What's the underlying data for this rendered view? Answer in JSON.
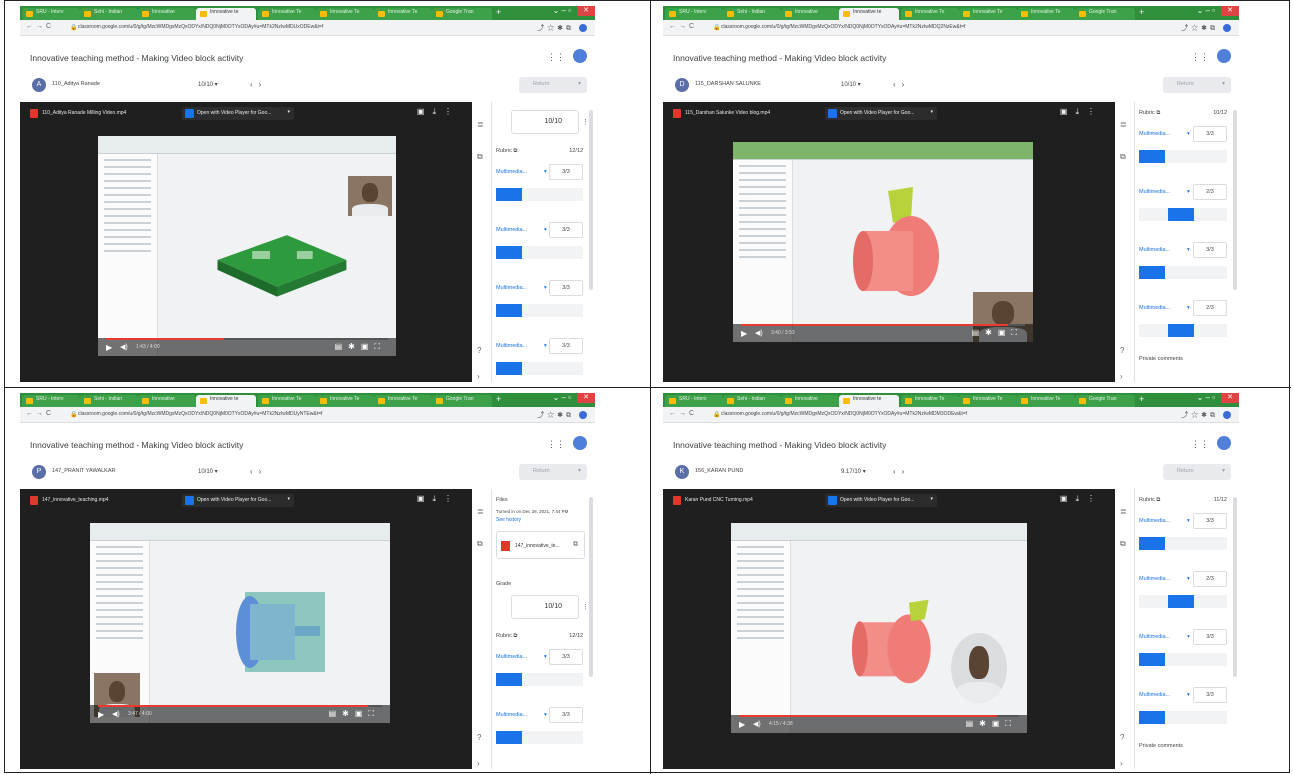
{
  "screens": [
    {
      "tabs": [
        "SRU - Interv",
        "Sehi - Indian",
        "Innovative",
        "Innovative te",
        "Innovative Te",
        "Innovative Te",
        "Innovative Te",
        "Google Tran"
      ],
      "url": "classroom.google.com/u/0/g/tg/MzcWMDgxMzQxODYx/NDQ0NjM0OTYxODAy#u=MTk2NzIwMDUxODEw&t=f",
      "title": "Innovative teaching method - Making Video block activity",
      "student": "110_Aditya Ranade",
      "student_initial": "A",
      "grade_select": "10/10",
      "return_label": "Return",
      "file_name": "110_Aditya Ranade Milling Video.mp4",
      "open_with": "Open with Video Player for Goo...",
      "time": "1:43 / 4:00",
      "progress": 0.42,
      "panel": {
        "grade_value": "10/10",
        "rubric_label": "Rubric",
        "rubric_total": "12/12",
        "criteria": [
          {
            "name": "Multimedia...",
            "score": "3/3",
            "level": 0
          },
          {
            "name": "Multimedia...",
            "score": "3/3",
            "level": 0
          },
          {
            "name": "Multimedia...",
            "score": "3/3",
            "level": 0
          },
          {
            "name": "Multimedia...",
            "score": "3/3",
            "level": 0
          }
        ]
      }
    },
    {
      "tabs": [
        "SRU - Interv",
        "Sehi - Indian",
        "Innovative",
        "Innovative te",
        "Innovative Te",
        "Innovative Te",
        "Innovative Te",
        "Google Tran"
      ],
      "url": "classroom.google.com/u/0/g/tg/MzcWMDgxMzQxODYx/NDQ0NjM0OTYxODAy#u=MTk2NzIwMDQ2NzEw&t=f",
      "title": "Innovative teaching method - Making Video block activity",
      "student": "115_DARSHAN SALUNKE",
      "student_initial": "D",
      "grade_select": "10/10",
      "return_label": "Return",
      "file_name": "115_Darshan Salunke Video blog.mp4",
      "open_with": "Open with Video Player for Goo...",
      "time": "3:40 / 3:53",
      "progress": 0.94,
      "panel": {
        "rubric_label": "Rubric",
        "rubric_total": "10/12",
        "criteria": [
          {
            "name": "Multimedia...",
            "score": "3/3",
            "level": 0
          },
          {
            "name": "Multimedia...",
            "score": "2/3",
            "level": 1
          },
          {
            "name": "Multimedia...",
            "score": "3/3",
            "level": 0
          },
          {
            "name": "Multimedia...",
            "score": "2/3",
            "level": 1
          }
        ],
        "private_comments": "Private comments"
      }
    },
    {
      "tabs": [
        "SRU - Interv",
        "Sehi - Indian",
        "Innovative",
        "Innovative te",
        "Innovative Te",
        "Innovative Te",
        "Innovative Te",
        "Google Tran"
      ],
      "url": "classroom.google.com/u/0/g/tg/MzcWMDgxMzQxODYx/NDQ0NjM0OTYxODAy#u=MTk2NzIwMDUyNTEw&t=f",
      "title": "Innovative teaching method - Making Video block activity",
      "student": "147_PRANIT YAWALKAR",
      "student_initial": "P",
      "grade_select": "10/10",
      "return_label": "Return",
      "file_name": "147_innovative_teaching.mp4",
      "open_with": "Open with Video Player for Goo...",
      "time": "3:47 / 4:00",
      "progress": 0.95,
      "panel": {
        "files_label": "Files",
        "turned_in": "Turned in on Dec 28, 2021, 7:44 PM",
        "see_history": "See history",
        "file_chip": "147_innovative_te...",
        "grade_label": "Grade",
        "grade_value": "10/10",
        "rubric_label": "Rubric",
        "rubric_total": "12/12",
        "criteria": [
          {
            "name": "Multimedia...",
            "score": "3/3",
            "level": 0
          },
          {
            "name": "Multimedia...",
            "score": "3/3",
            "level": 0
          }
        ]
      }
    },
    {
      "tabs": [
        "SRU - Interv",
        "Sehi - Indian",
        "Innovative",
        "Innovative te",
        "Innovative Te",
        "Innovative Te",
        "Innovative Te",
        "Google Tran"
      ],
      "url": "classroom.google.com/u/0/g/tg/MzcWMDgxMzQxODYx/NDQ0NjM0OTYxODAy#u=MTk2NzIwMDM3ODEw&t=f",
      "title": "Innovative teaching method - Making Video block activity",
      "student": "156_KARAN PUND",
      "student_initial": "K",
      "grade_select": "9.17/10",
      "return_label": "Return",
      "file_name": "Karan Pund CNC Turning.mp4",
      "open_with": "Open with Video Player for Goo...",
      "time": "4:15 / 4:38",
      "progress": 0.92,
      "panel": {
        "rubric_label": "Rubric",
        "rubric_total": "11/12",
        "criteria": [
          {
            "name": "Multimedia...",
            "score": "3/3",
            "level": 0
          },
          {
            "name": "Multimedia...",
            "score": "2/3",
            "level": 1
          },
          {
            "name": "Multimedia...",
            "score": "3/3",
            "level": 0
          },
          {
            "name": "Multimedia...",
            "score": "3/3",
            "level": 0
          }
        ],
        "private_comments": "Private comments"
      }
    }
  ],
  "colors": {
    "accent": "#1a73e8",
    "tabstrip": "#2f8f3b",
    "progress": "#e63b2e"
  },
  "icons": [
    "back-icon",
    "forward-icon",
    "refresh-icon",
    "lock-icon",
    "star-icon",
    "extensions-icon",
    "apps-grid-icon",
    "print-icon",
    "download-icon",
    "more-icon",
    "play-icon",
    "volume-icon",
    "settings-icon",
    "fullscreen-icon",
    "rubric-icon"
  ]
}
